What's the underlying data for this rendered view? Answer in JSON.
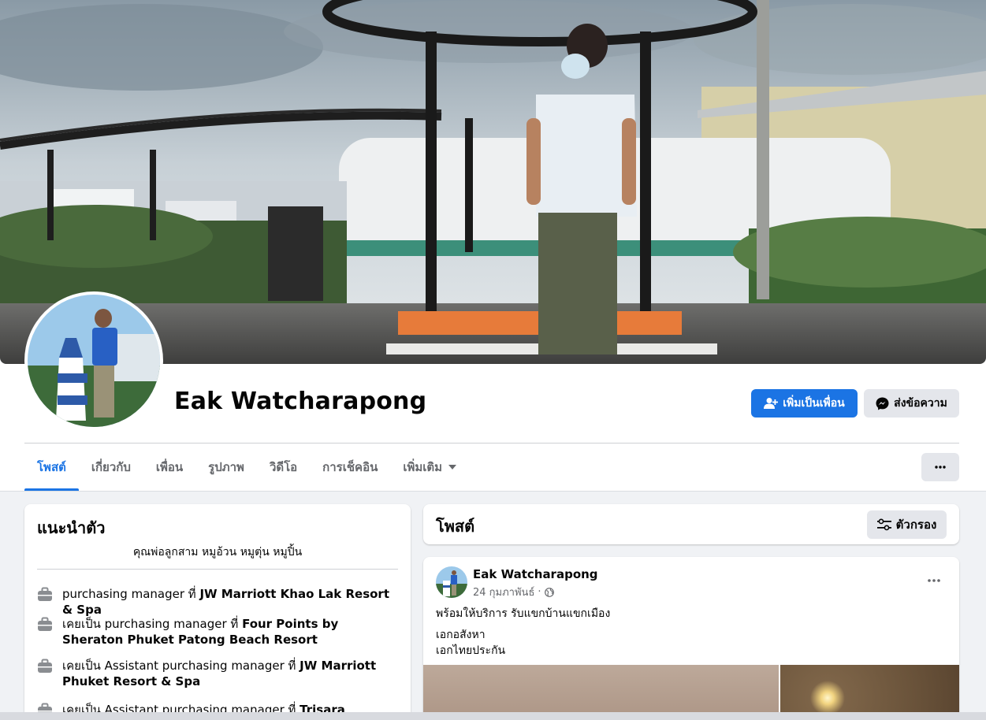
{
  "profile": {
    "name": "Eak Watcharapong",
    "add_friend_label": "เพิ่มเป็นเพื่อน",
    "message_label": "ส่งข้อความ"
  },
  "tabs": [
    {
      "label": "โพสต์",
      "active": true
    },
    {
      "label": "เกี่ยวกับ",
      "active": false
    },
    {
      "label": "เพื่อน",
      "active": false
    },
    {
      "label": "รูปภาพ",
      "active": false
    },
    {
      "label": "วิดีโอ",
      "active": false
    },
    {
      "label": "การเช็คอิน",
      "active": false
    },
    {
      "label": "เพิ่มเติม",
      "active": false
    }
  ],
  "intro": {
    "title": "แนะนำตัว",
    "bio": "คุณพ่อลูกสาม หมูอ้วน หมูตุ่น หมูปิ้น",
    "work": [
      {
        "prefix": "purchasing manager ที่ ",
        "place": "JW Marriott Khao Lak Resort & Spa"
      },
      {
        "prefix": "เคยเป็น purchasing manager ที่ ",
        "place": "Four Points by Sheraton Phuket Patong Beach Resort"
      },
      {
        "prefix": "เคยเป็น Assistant purchasing manager ที่ ",
        "place": "JW Marriott Phuket Resort & Spa"
      },
      {
        "prefix": "เคยเป็น Assistant purchasing manager ที่ ",
        "place": "Trisara"
      }
    ]
  },
  "posts": {
    "title": "โพสต์",
    "filter_label": "ตัวกรอง"
  },
  "post": {
    "author": "Eak Watcharapong",
    "date": "24 กุมภาพันธ์",
    "line1": "พร้อมให้บริการ รับแขกบ้านแขกเมือง",
    "line2": "เอกอสังหา",
    "line3": "เอกไทยประกัน"
  },
  "colors": {
    "accent": "#1b74e4",
    "secondary_button": "#e4e6eb",
    "page_bg": "#f0f2f5",
    "muted_text": "#65676b"
  }
}
